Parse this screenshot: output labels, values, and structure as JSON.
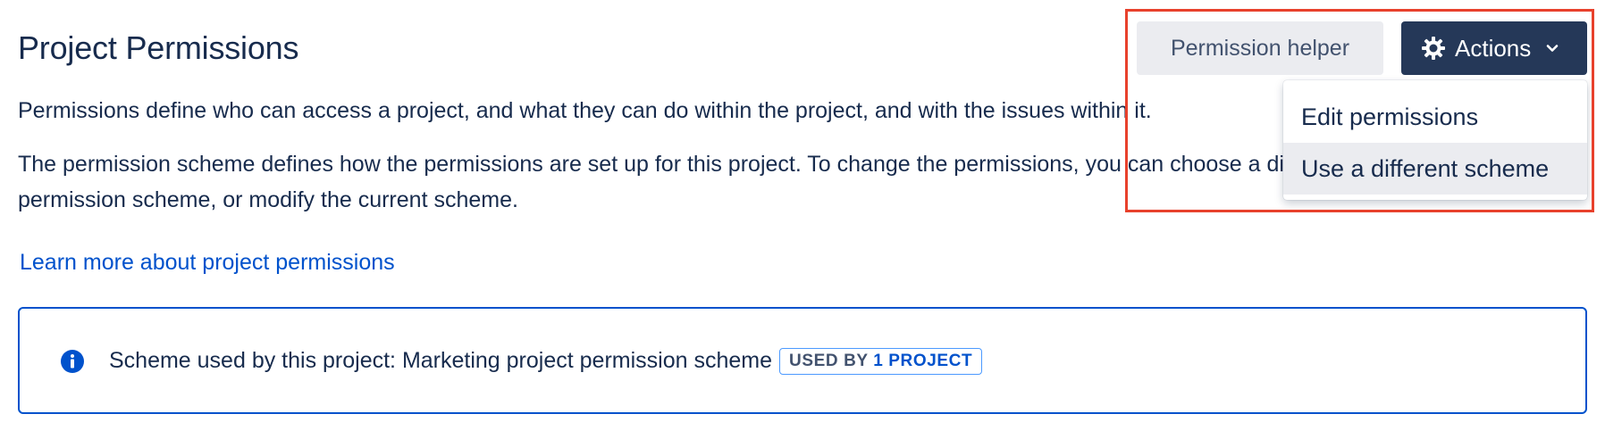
{
  "header": {
    "title": "Project Permissions"
  },
  "description": {
    "line1": "Permissions define who can access a project, and what they can do within the project, and with the issues within it.",
    "line2a": "The permission scheme defines how the permissions are set up for this project. To change the permissions, you can choose a different",
    "line2b": "permission scheme, or modify the current scheme."
  },
  "learn_more": {
    "label": "Learn more about project permissions"
  },
  "info_panel": {
    "icon": "info-icon",
    "text": "Scheme used by this project: Marketing project permission scheme",
    "lozenge_prefix": "USED BY ",
    "lozenge_count": "1 PROJECT"
  },
  "toolbar": {
    "helper_label": "Permission helper",
    "actions_label": "Actions",
    "actions_icon": "gear-icon",
    "actions_chevron": "chevron-down-icon"
  },
  "actions_menu": {
    "items": [
      {
        "label": "Edit permissions"
      },
      {
        "label": "Use a different scheme"
      }
    ]
  },
  "colors": {
    "text": "#172b4d",
    "link": "#0052cc",
    "panel_border": "#0052cc",
    "actions_bg": "#253858",
    "helper_bg": "#ebecf0",
    "menu_hover": "#ebecf0",
    "annotation": "#e8412c"
  }
}
